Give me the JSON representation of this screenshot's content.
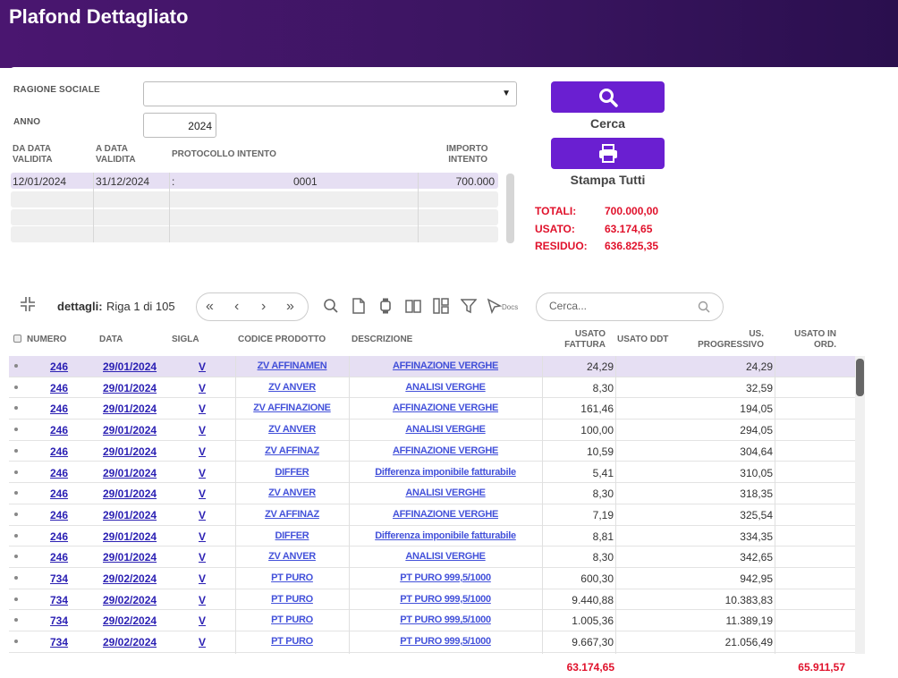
{
  "header": {
    "title": "Plafond Dettagliato"
  },
  "form": {
    "ragione_sociale_label": "RAGIONE SOCIALE",
    "ragione_sociale_value": "",
    "anno_label": "ANNO",
    "anno_value": "2024"
  },
  "intent_grid": {
    "columns": [
      "DA DATA VALIDITA",
      "A DATA VALIDITA",
      "PROTOCOLLO INTENTO",
      "IMPORTO INTENTO"
    ],
    "col_lines": [
      [
        "DA DATA",
        "VALIDITA"
      ],
      [
        "A DATA",
        "VALIDITA"
      ],
      [
        "PROTOCOLLO INTENTO"
      ],
      [
        "IMPORTO",
        "INTENTO"
      ]
    ],
    "rows": [
      {
        "da": "12/01/2024",
        "a": "31/12/2024",
        "prefix": ":",
        "protocollo": "0001",
        "importo": "700.000"
      }
    ]
  },
  "actions": {
    "cerca_label": "Cerca",
    "stampa_label": "Stampa Tutti"
  },
  "totals": {
    "totali_label": "TOTALI:",
    "totali_value": "700.000,00",
    "usato_label": "USATO:",
    "usato_value": "63.174,65",
    "residuo_label": "RESIDUO:",
    "residuo_value": "636.825,35"
  },
  "toolbar": {
    "section_label": "dettagli:",
    "page_info": "Riga 1 di 105",
    "docs_label": "Docs",
    "search_placeholder": "Cerca..."
  },
  "grid": {
    "headers": {
      "numero": "NUMERO",
      "data": "DATA",
      "sigla": "SIGLA",
      "codice": "CODICE PRODOTTO",
      "descrizione": "DESCRIZIONE",
      "usato_fattura": [
        "USATO",
        "FATTURA"
      ],
      "usato_ddt": "USATO DDT",
      "progressivo": [
        "US.",
        "PROGRESSIVO"
      ],
      "usato_ord": [
        "USATO IN",
        "ORD."
      ]
    },
    "rows": [
      {
        "numero": "246",
        "data": "29/01/2024",
        "sigla": "V",
        "codice": "ZV AFFINAMEN",
        "descrizione": "AFFINAZIONE VERGHE",
        "usato_fattura": "24,29",
        "progressivo": "24,29"
      },
      {
        "numero": "246",
        "data": "29/01/2024",
        "sigla": "V",
        "codice": "ZV ANVER",
        "descrizione": "ANALISI VERGHE",
        "usato_fattura": "8,30",
        "progressivo": "32,59"
      },
      {
        "numero": "246",
        "data": "29/01/2024",
        "sigla": "V",
        "codice": "ZV AFFINAZIONE",
        "descrizione": "AFFINAZIONE VERGHE",
        "usato_fattura": "161,46",
        "progressivo": "194,05"
      },
      {
        "numero": "246",
        "data": "29/01/2024",
        "sigla": "V",
        "codice": "ZV ANVER",
        "descrizione": "ANALISI VERGHE",
        "usato_fattura": "100,00",
        "progressivo": "294,05"
      },
      {
        "numero": "246",
        "data": "29/01/2024",
        "sigla": "V",
        "codice": "ZV AFFINAZ",
        "descrizione": "AFFINAZIONE VERGHE",
        "usato_fattura": "10,59",
        "progressivo": "304,64"
      },
      {
        "numero": "246",
        "data": "29/01/2024",
        "sigla": "V",
        "codice": "DIFFER",
        "descrizione": "Differenza imponibile fatturabile",
        "usato_fattura": "5,41",
        "progressivo": "310,05"
      },
      {
        "numero": "246",
        "data": "29/01/2024",
        "sigla": "V",
        "codice": "ZV ANVER",
        "descrizione": "ANALISI VERGHE",
        "usato_fattura": "8,30",
        "progressivo": "318,35"
      },
      {
        "numero": "246",
        "data": "29/01/2024",
        "sigla": "V",
        "codice": "ZV AFFINAZ",
        "descrizione": "AFFINAZIONE VERGHE",
        "usato_fattura": "7,19",
        "progressivo": "325,54"
      },
      {
        "numero": "246",
        "data": "29/01/2024",
        "sigla": "V",
        "codice": "DIFFER",
        "descrizione": "Differenza imponibile fatturabile",
        "usato_fattura": "8,81",
        "progressivo": "334,35"
      },
      {
        "numero": "246",
        "data": "29/01/2024",
        "sigla": "V",
        "codice": "ZV ANVER",
        "descrizione": "ANALISI VERGHE",
        "usato_fattura": "8,30",
        "progressivo": "342,65"
      },
      {
        "numero": "734",
        "data": "29/02/2024",
        "sigla": "V",
        "codice": "PT PURO",
        "descrizione": "PT PURO 999,5/1000",
        "usato_fattura": "600,30",
        "progressivo": "942,95"
      },
      {
        "numero": "734",
        "data": "29/02/2024",
        "sigla": "V",
        "codice": "PT PURO",
        "descrizione": "PT PURO 999,5/1000",
        "usato_fattura": "9.440,88",
        "progressivo": "10.383,83"
      },
      {
        "numero": "734",
        "data": "29/02/2024",
        "sigla": "V",
        "codice": "PT PURO",
        "descrizione": "PT PURO 999,5/1000",
        "usato_fattura": "1.005,36",
        "progressivo": "11.389,19"
      },
      {
        "numero": "734",
        "data": "29/02/2024",
        "sigla": "V",
        "codice": "PT PURO",
        "descrizione": "PT PURO 999,5/1000",
        "usato_fattura": "9.667,30",
        "progressivo": "21.056,49"
      }
    ],
    "footer": {
      "usato_fattura_total": "63.174,65",
      "usato_ord_total": "65.911,57"
    }
  },
  "colors": {
    "accent": "#6a1fd1",
    "header_bg": "#3b1561",
    "total_red": "#e0112b",
    "link_blue": "#2a1fb3",
    "selected_row": "#e6dff3"
  }
}
